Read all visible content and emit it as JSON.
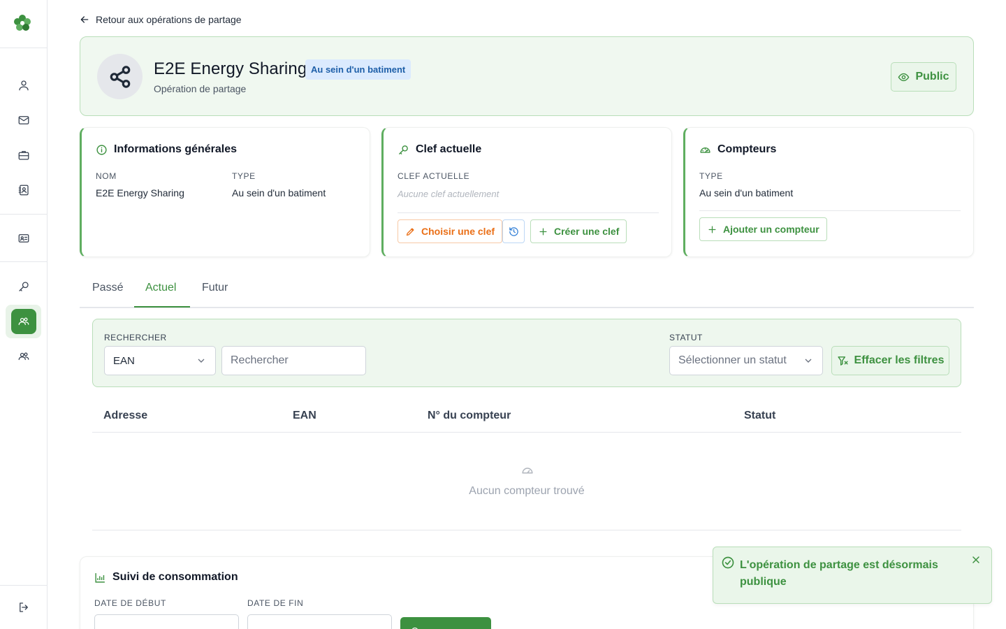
{
  "nav": {
    "back_label": "Retour aux opérations de partage"
  },
  "header": {
    "title": "E2E Energy Sharing",
    "badge": "Au sein d'un batiment",
    "subtitle": "Opération de partage",
    "visibility_button": "Public"
  },
  "cards": {
    "general": {
      "title": "Informations générales",
      "name_label": "NOM",
      "name_value": "E2E Energy Sharing",
      "type_label": "TYPE",
      "type_value": "Au sein d'un batiment"
    },
    "key": {
      "title": "Clef actuelle",
      "current_label": "CLEF ACTUELLE",
      "current_value": "Aucune clef actuellement",
      "choose_button": "Choisir une clef",
      "create_button": "Créer une clef"
    },
    "meters": {
      "title": "Compteurs",
      "type_label": "TYPE",
      "type_value": "Au sein d'un batiment",
      "add_button": "Ajouter un compteur"
    }
  },
  "tabs": [
    {
      "label": "Passé",
      "active": false
    },
    {
      "label": "Actuel",
      "active": true
    },
    {
      "label": "Futur",
      "active": false
    }
  ],
  "filters": {
    "search_label": "RECHERCHER",
    "search_field_value": "EAN",
    "search_placeholder": "Rechercher",
    "status_label": "STATUT",
    "status_placeholder": "Sélectionner un statut",
    "clear_button": "Effacer les filtres"
  },
  "table": {
    "columns": [
      "Adresse",
      "EAN",
      "N° du compteur",
      "Statut"
    ],
    "empty_message": "Aucun compteur trouvé"
  },
  "consumption": {
    "title": "Suivi de consommation",
    "start_label": "DATE DE DÉBUT",
    "end_label": "DATE DE FIN"
  },
  "toast": {
    "message": "L'opération de partage est désormais publique"
  },
  "colors": {
    "primary_green": "#3d9140",
    "badge_blue_bg": "#dbeafe",
    "badge_blue_text": "#1e5fa8",
    "orange": "#ea6f17"
  }
}
